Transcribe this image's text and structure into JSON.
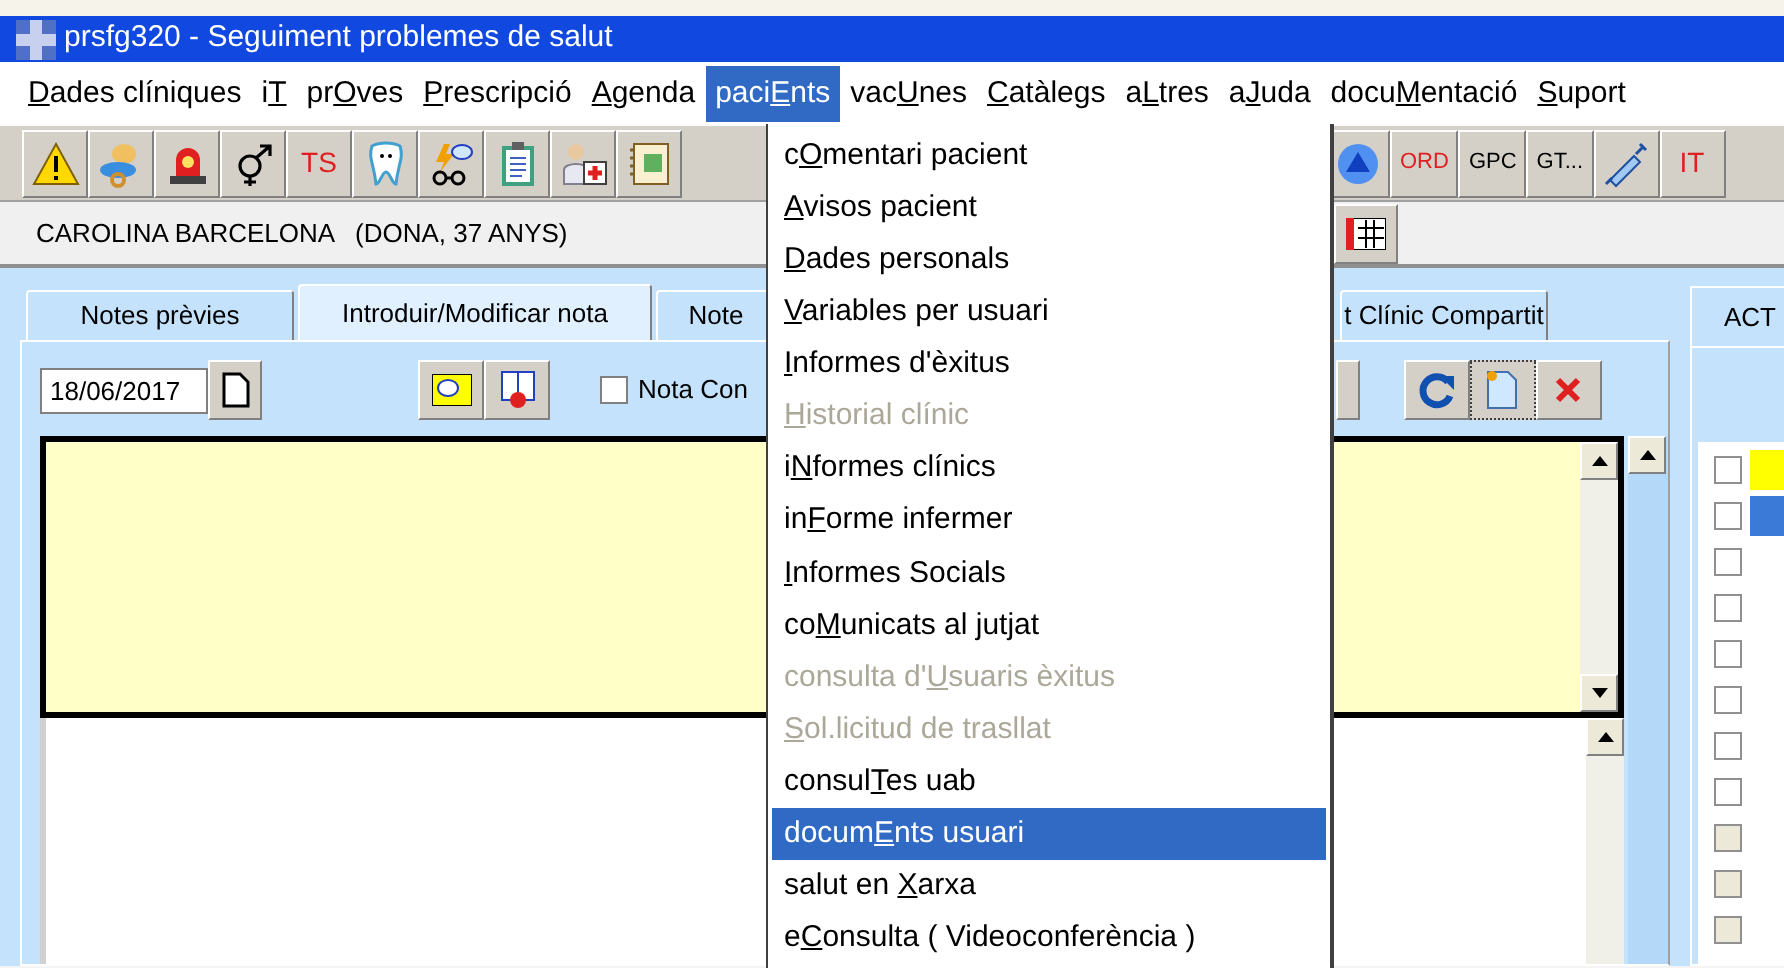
{
  "window": {
    "title": "prsfg320 - Seguiment problemes de salut"
  },
  "menu_bar": [
    {
      "key": "D",
      "post": "ades clíniques",
      "selected": false
    },
    {
      "pre": "i",
      "key": "T",
      "selected": false
    },
    {
      "pre": "pr",
      "key": "O",
      "post": "ves",
      "selected": false
    },
    {
      "key": "P",
      "post": "rescripció",
      "selected": false
    },
    {
      "key": "A",
      "post": "genda",
      "selected": false
    },
    {
      "pre": "paci",
      "key": "E",
      "post": "nts",
      "selected": true
    },
    {
      "pre": "vac",
      "key": "U",
      "post": "nes",
      "selected": false
    },
    {
      "key": "C",
      "post": "atàlegs",
      "selected": false
    },
    {
      "pre": "a",
      "key": "L",
      "post": "tres",
      "selected": false
    },
    {
      "pre": "a",
      "key": "J",
      "post": "uda",
      "selected": false
    },
    {
      "pre": "docu",
      "key": "M",
      "post": "entació",
      "selected": false
    },
    {
      "key": "S",
      "post": "uport",
      "selected": false
    }
  ],
  "toolbar_left": [
    {
      "kind": "icon"
    },
    {
      "kind": "icon"
    },
    {
      "kind": "icon"
    },
    {
      "kind": "icon"
    },
    {
      "kind": "text",
      "label": "TS",
      "color": "#e02020"
    },
    {
      "kind": "icon"
    },
    {
      "kind": "icon"
    },
    {
      "kind": "icon"
    },
    {
      "kind": "icon"
    },
    {
      "kind": "icon"
    }
  ],
  "toolbar_right": [
    {
      "kind": "icon"
    },
    {
      "kind": "text",
      "label": "ORD",
      "color": "#e02020"
    },
    {
      "kind": "text",
      "label": "GPC",
      "color": "#000000"
    },
    {
      "kind": "text",
      "label": "GT...",
      "color": "#000000"
    },
    {
      "kind": "icon"
    },
    {
      "kind": "text",
      "label": "IT",
      "color": "#e02020"
    }
  ],
  "patient": {
    "name": "CAROLINA BARCELONA",
    "info": "(DONA, 37 ANYS)"
  },
  "tabs": [
    {
      "label": "Notes prèvies",
      "selected": false
    },
    {
      "label": "Introduir/Modificar nota",
      "selected": true
    },
    {
      "label": "Note",
      "selected": false
    },
    {
      "label": "t Clínic Compartit",
      "selected": false
    }
  ],
  "note_form": {
    "date": "18/06/2017",
    "confidential": {
      "label": "Nota Con",
      "checked": false
    }
  },
  "side_panel": {
    "tab": "ACT",
    "rows": [
      {
        "checked": false,
        "disabled": false,
        "color": "#ffff00"
      },
      {
        "checked": false,
        "disabled": false,
        "color": "#3c7ad8"
      },
      {
        "checked": false,
        "disabled": false
      },
      {
        "checked": false,
        "disabled": false
      },
      {
        "checked": false,
        "disabled": false
      },
      {
        "checked": false,
        "disabled": false
      },
      {
        "checked": false,
        "disabled": false
      },
      {
        "checked": false,
        "disabled": false
      },
      {
        "checked": false,
        "disabled": true
      },
      {
        "checked": false,
        "disabled": true
      },
      {
        "checked": false,
        "disabled": true
      }
    ]
  },
  "dropdown": [
    {
      "pre": "c",
      "key": "O",
      "post": "mentari pacient",
      "disabled": false,
      "selected": false
    },
    {
      "key": "A",
      "post": "visos pacient",
      "disabled": false,
      "selected": false
    },
    {
      "key": "D",
      "post": "ades personals",
      "disabled": false,
      "selected": false
    },
    {
      "key": "V",
      "post": "ariables per usuari",
      "disabled": false,
      "selected": false
    },
    {
      "key": "I",
      "post": "nformes d'èxitus",
      "disabled": false,
      "selected": false
    },
    {
      "key": "H",
      "post": "istorial clínic",
      "disabled": true,
      "selected": false
    },
    {
      "pre": "i",
      "key": "N",
      "post": "formes clínics",
      "disabled": false,
      "selected": false
    },
    {
      "pre": "in",
      "key": "F",
      "post": "orme infermer",
      "disabled": false,
      "selected": false
    },
    {
      "key": "I",
      "post": "nformes Socials",
      "disabled": false,
      "selected": false
    },
    {
      "pre": "co",
      "key": "M",
      "post": "unicats al jutjat",
      "disabled": false,
      "selected": false
    },
    {
      "pre": "consulta d'",
      "key": "U",
      "post": "suaris èxitus",
      "disabled": true,
      "selected": false
    },
    {
      "key": "S",
      "post": "ol.licitud de trasllat",
      "disabled": true,
      "selected": false
    },
    {
      "pre": "consul",
      "key": "T",
      "post": "es uab",
      "disabled": false,
      "selected": false
    },
    {
      "pre": "docum",
      "key": "E",
      "post": "nts usuari",
      "disabled": false,
      "selected": true
    },
    {
      "pre": "salut en ",
      "key": "X",
      "post": "arxa",
      "disabled": false,
      "selected": false
    },
    {
      "pre": "e",
      "key": "C",
      "post": "onsulta ( Videoconferència )",
      "disabled": false,
      "selected": false
    }
  ]
}
